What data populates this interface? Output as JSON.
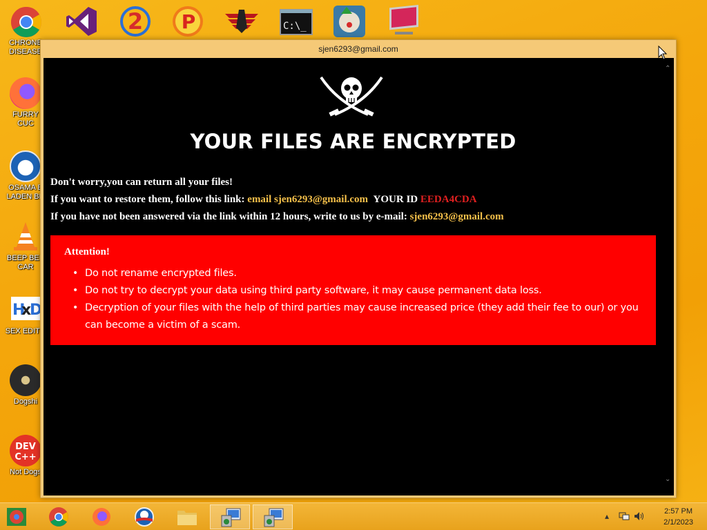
{
  "desktop": {
    "icons": [
      {
        "name": "chrome",
        "label": "CHRONE\nDISEASE"
      },
      {
        "name": "firefox",
        "label": "FURRY CUC"
      },
      {
        "name": "obama",
        "label": "OSAMA B\nLADEN BR"
      },
      {
        "name": "vlc",
        "label": "BEEP BEE\nCAR"
      },
      {
        "name": "hxd",
        "label": "SEX EDITO"
      },
      {
        "name": "dogshit",
        "label": "Dogshi"
      },
      {
        "name": "devcpp",
        "label": "Not Dogs"
      }
    ]
  },
  "window": {
    "title": "sjen6293@gmail.com"
  },
  "ransom": {
    "headline": "YOUR FILES ARE ENCRYPTED",
    "line1": "Don't worry,you can return all your files!",
    "line2_prefix": "If you want to restore them, follow this link: ",
    "line2_link": "email sjen6293@gmail.com",
    "line2_id_label": "YOUR ID ",
    "line2_id_value": "EEDA4CDA",
    "line3_prefix": "If you have not been answered via the link within 12 hours, write to us by e-mail: ",
    "line3_email": "sjen6293@gmail.com",
    "attention_title": "Attention!",
    "attention_items": [
      "Do not rename encrypted files.",
      "Do not try to decrypt your data using third party software, it may cause permanent data loss.",
      "Decryption of your files with the help of third parties may cause increased price (they add their fee to our) or you can become a victim of a scam."
    ]
  },
  "taskbar": {
    "time": "2:57 PM",
    "date": "2/1/2023"
  },
  "colors": {
    "gold": "#f5c04a",
    "id_red": "#e02020",
    "attention_bg": "#ff0000",
    "desktop": "#f4a70c"
  }
}
